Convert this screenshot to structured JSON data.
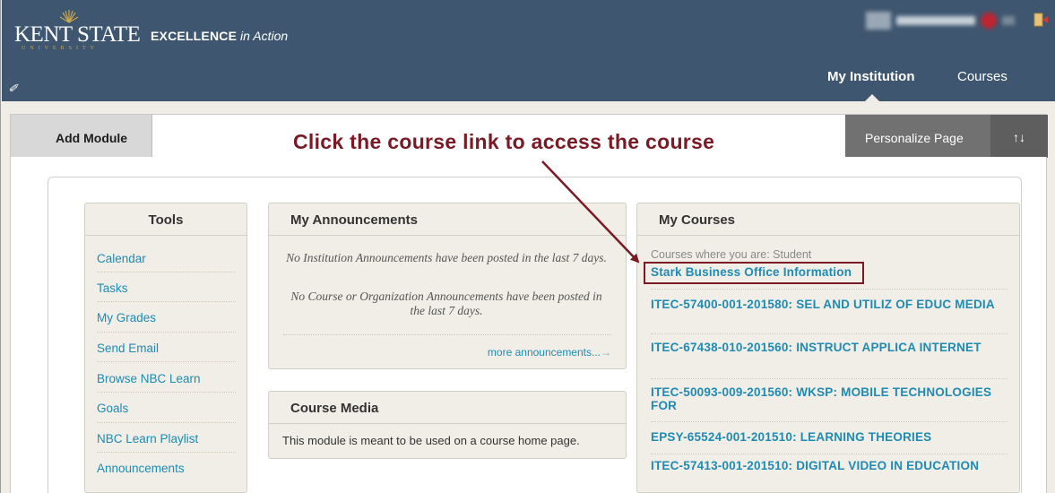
{
  "header": {
    "logo_text": "KENT STATE",
    "logo_sub": "UNIVERSITY",
    "tagline_bold": "EXCELLENCE",
    "tagline_italic": " in Action",
    "tabs": [
      {
        "label": "My Institution",
        "active": true
      },
      {
        "label": "Courses",
        "active": false
      }
    ],
    "colors": {
      "header_bg": "#3e566f",
      "accent": "#c9a84c"
    }
  },
  "toolbar": {
    "add_module_label": "Add Module",
    "personalize_label": "Personalize Page",
    "reorder_label": "↑↓"
  },
  "annotation": {
    "instruction": "Click the course link to access the course",
    "color": "#7a1a24"
  },
  "tools_module": {
    "title": "Tools",
    "items": [
      {
        "label": "Calendar"
      },
      {
        "label": "Tasks"
      },
      {
        "label": "My Grades"
      },
      {
        "label": "Send Email"
      },
      {
        "label": "Browse NBC Learn"
      },
      {
        "label": "Goals"
      },
      {
        "label": "NBC Learn Playlist"
      },
      {
        "label": "Announcements"
      }
    ]
  },
  "announcements_module": {
    "title": "My Announcements",
    "institution_text": "No Institution Announcements have been posted in the last 7 days.",
    "course_text": "No Course or Organization Announcements have been posted in the last 7 days.",
    "more_label": "more announcements...",
    "more_arrow": "→"
  },
  "course_media_module": {
    "title": "Course Media",
    "text": "This module is meant to be used on a course home page."
  },
  "courses_module": {
    "title": "My Courses",
    "role_text": "Courses where you are: Student",
    "courses": [
      {
        "label": "Stark Business Office Information",
        "highlighted": true
      },
      {
        "label": "ITEC-57400-001-201580: SEL AND UTILIZ OF EDUC MEDIA"
      },
      {
        "label": "ITEC-67438-010-201560: INSTRUCT APPLICA INTERNET"
      },
      {
        "label": "ITEC-50093-009-201560: WKSP: MOBILE TECHNOLOGIES FOR"
      },
      {
        "label": "EPSY-65524-001-201510: LEARNING THEORIES"
      },
      {
        "label": "ITEC-57413-001-201510: DIGITAL VIDEO IN EDUCATION"
      }
    ]
  },
  "icons": {
    "edit": "paperclip-edit-icon",
    "logout": "logout-door-icon",
    "logo": "sunburst-logo-icon"
  }
}
